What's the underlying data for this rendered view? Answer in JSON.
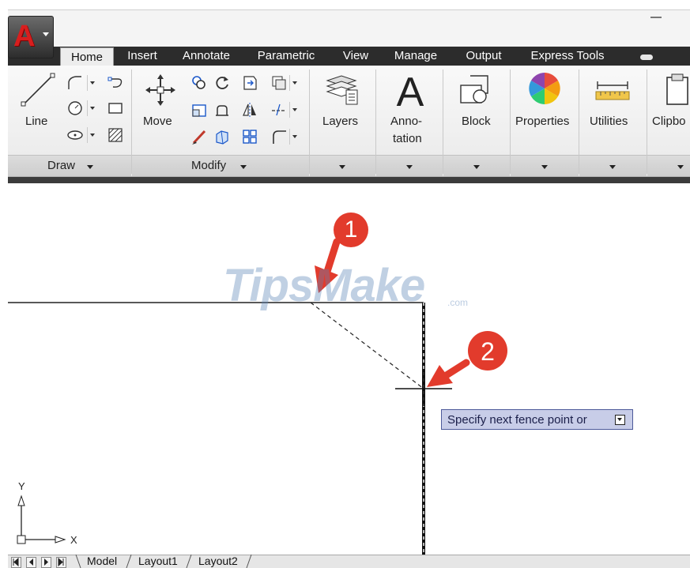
{
  "app": {
    "logo_letter": "A"
  },
  "ribbon_tabs": [
    "Home",
    "Insert",
    "Annotate",
    "Parametric",
    "View",
    "Manage",
    "Output",
    "Express Tools"
  ],
  "active_tab": "Home",
  "draw_panel": {
    "line_label": "Line",
    "footer": "Draw"
  },
  "modify_panel": {
    "move_label": "Move",
    "footer": "Modify"
  },
  "large_panels": {
    "layers": "Layers",
    "annotation_line1": "Anno-",
    "annotation_line2": "tation",
    "block": "Block",
    "properties": "Properties",
    "utilities": "Utilities",
    "clipboard": "Clipbo"
  },
  "callouts": {
    "one": "1",
    "two": "2"
  },
  "watermark": {
    "brand": "TipsMake",
    "suffix": ".com"
  },
  "tooltip": {
    "text": "Specify next fence point or"
  },
  "ucs": {
    "x_label": "X",
    "y_label": "Y"
  },
  "layout_tabs": [
    "Model",
    "Layout1",
    "Layout2"
  ],
  "colors": {
    "ribbon_dark": "#2c2c2c",
    "callout_red": "#e23b2c",
    "tooltip_bg": "#c8cde8",
    "watermark_blue": "#5b85b8"
  }
}
